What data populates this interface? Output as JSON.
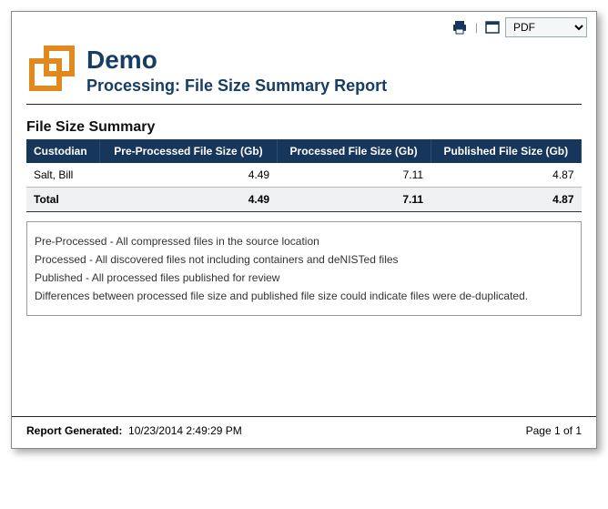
{
  "toolbar": {
    "export_selected": "PDF"
  },
  "header": {
    "title": "Demo",
    "subtitle": "Processing: File Size Summary Report"
  },
  "section_title": "File Size Summary",
  "table": {
    "headers": {
      "custodian": "Custodian",
      "preprocessed": "Pre-Processed File Size (Gb)",
      "processed": "Processed File Size (Gb)",
      "published": "Published File Size (Gb)"
    },
    "rows": [
      {
        "custodian": "Salt, Bill",
        "pre": "4.49",
        "proc": "7.11",
        "pub": "4.87"
      }
    ],
    "total": {
      "label": "Total",
      "pre": "4.49",
      "proc": "7.11",
      "pub": "4.87"
    }
  },
  "notes": {
    "n1": "Pre-Processed - All compressed files in the source location",
    "n2": "Processed - All discovered files not including containers and deNISTed files",
    "n3": "Published - All processed files published for review",
    "n4": "Differences between processed file size and published file size could indicate files were de-duplicated."
  },
  "footer": {
    "generated_label": "Report Generated:",
    "generated_value": "10/23/2014 2:49:29 PM",
    "page_label": "Page 1 of 1"
  },
  "chart_data": {
    "type": "table",
    "title": "File Size Summary",
    "columns": [
      "Custodian",
      "Pre-Processed File Size (Gb)",
      "Processed File Size (Gb)",
      "Published File Size (Gb)"
    ],
    "rows": [
      [
        "Salt, Bill",
        4.49,
        7.11,
        4.87
      ]
    ],
    "total": [
      "Total",
      4.49,
      7.11,
      4.87
    ]
  }
}
